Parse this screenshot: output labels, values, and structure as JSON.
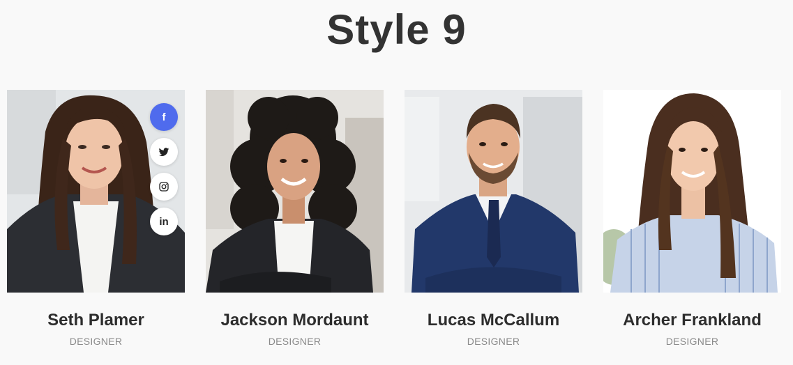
{
  "page": {
    "title": "Style 9"
  },
  "members": [
    {
      "name": "Seth Plamer",
      "role": "DESIGNER"
    },
    {
      "name": "Jackson Mordaunt",
      "role": "DESIGNER"
    },
    {
      "name": "Lucas McCallum",
      "role": "DESIGNER"
    },
    {
      "name": "Archer Frankland",
      "role": "DESIGNER"
    }
  ],
  "social": [
    {
      "icon": "facebook-icon",
      "glyph": "f"
    },
    {
      "icon": "twitter-icon",
      "glyph": ""
    },
    {
      "icon": "instagram-icon",
      "glyph": ""
    },
    {
      "icon": "linkedin-icon",
      "glyph": "in"
    }
  ],
  "colors": {
    "accent": "#4f6bed",
    "background": "#f9f9f9",
    "text": "#2d2d2d",
    "muted": "#8a8a8a"
  }
}
